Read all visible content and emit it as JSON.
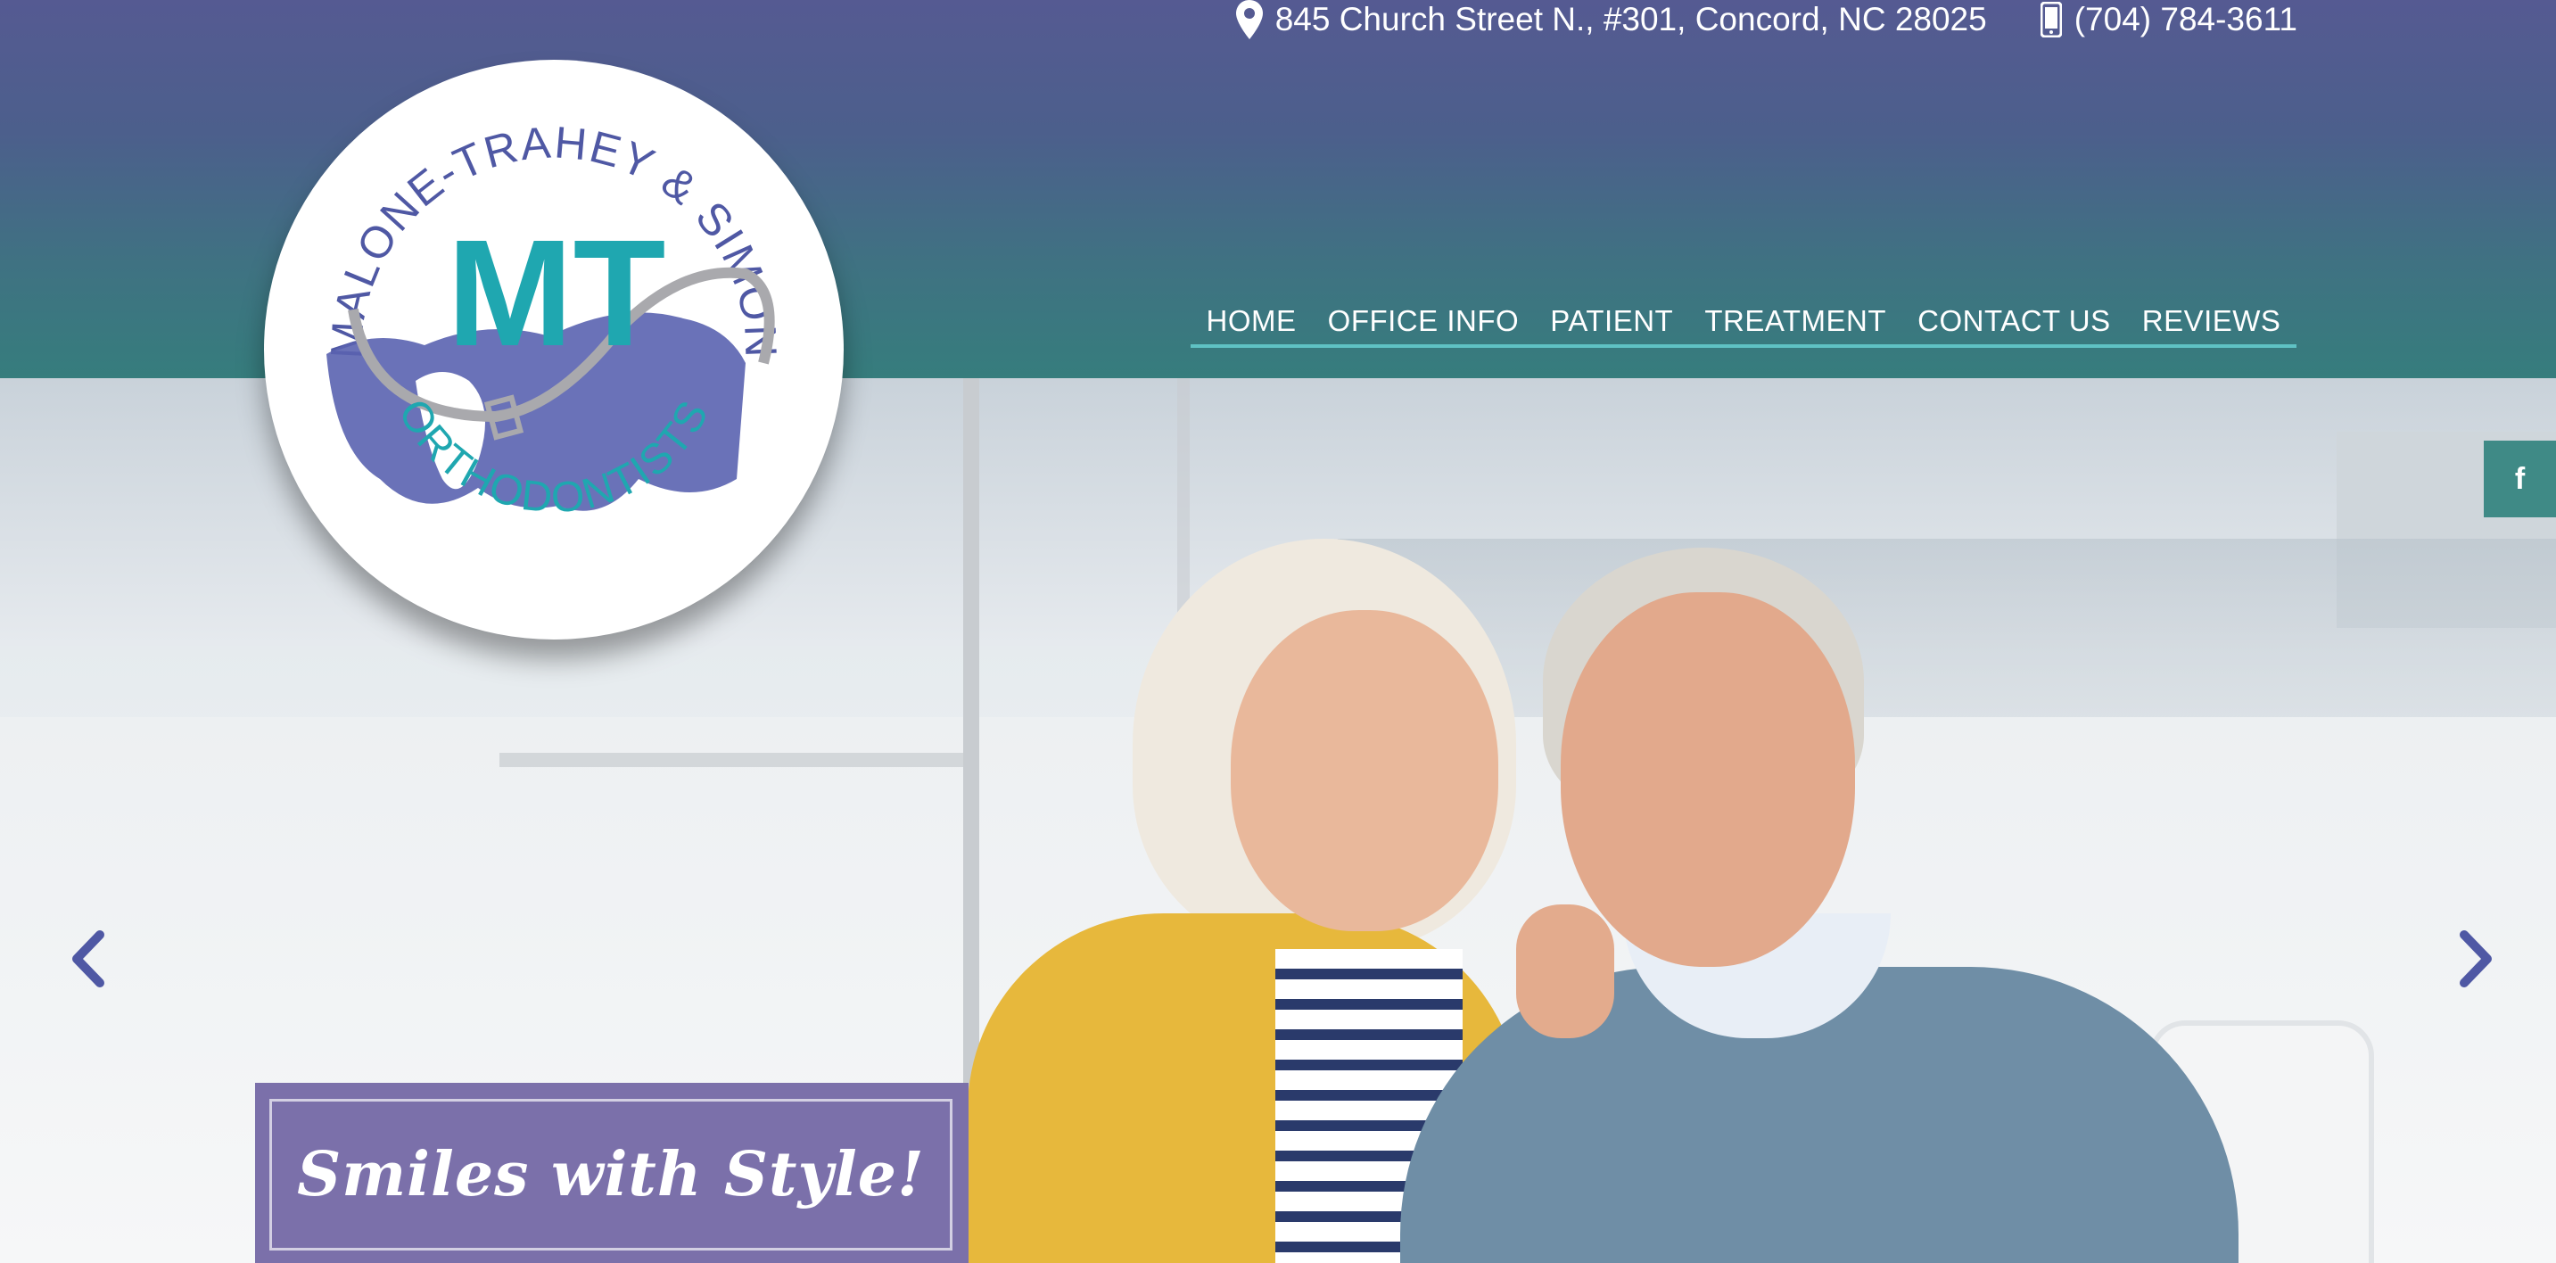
{
  "topbar": {
    "address": "845 Church Street N., #301, Concord, NC 28025",
    "phone": "(704) 784-3611",
    "address_icon": "map-pin-icon",
    "phone_icon": "mobile-phone-icon"
  },
  "logo": {
    "top_text": "MALONE-TRAHEY & SIMON",
    "letters": "MT",
    "bottom_text": "ORTHODONTISTS"
  },
  "nav": {
    "items": [
      {
        "label": "HOME"
      },
      {
        "label": "OFFICE INFO"
      },
      {
        "label": "PATIENT"
      },
      {
        "label": "TREATMENT"
      },
      {
        "label": "CONTACT US"
      },
      {
        "label": "REVIEWS"
      }
    ]
  },
  "hero": {
    "tagline": "Smiles with Style!",
    "prev_icon": "chevron-left-icon",
    "next_icon": "chevron-right-icon"
  },
  "social": {
    "facebook_label": "f",
    "facebook_icon": "facebook-icon"
  },
  "colors": {
    "header_top": "#555a92",
    "header_bottom": "#367d7d",
    "nav_underline": "#5fc2c4",
    "logo_purple": "#4f58a4",
    "logo_teal": "#1fa7b0",
    "tagline_bg": "#7b70aa"
  }
}
